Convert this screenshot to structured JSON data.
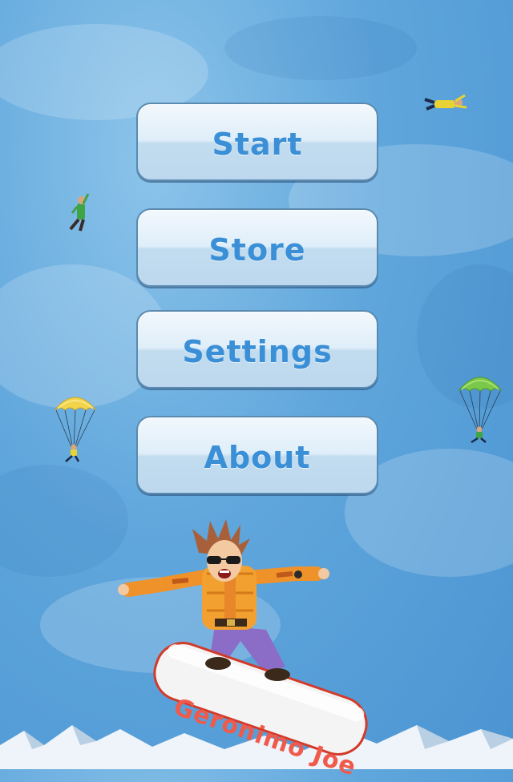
{
  "menu": {
    "start_label": "Start",
    "store_label": "Store",
    "settings_label": "Settings",
    "about_label": "About"
  },
  "character": {
    "board_text": "Geronimo Joe"
  },
  "colors": {
    "sky": "#5fa6dc",
    "button_text": "#3a8fd6",
    "board_text": "#f05a4b",
    "parachute_yellow": "#f2d34a",
    "parachute_green": "#7cc84a"
  },
  "icons": [
    "skydiver-icon",
    "parachutist-icon",
    "snowboarder-character",
    "mountains"
  ]
}
